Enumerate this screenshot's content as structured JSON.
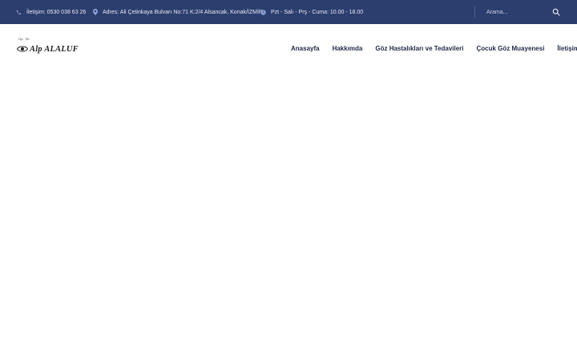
{
  "topbar": {
    "phone": "İletişim: 0530 038 63 26",
    "address": "Adres: Ali Çetinkaya Bulvarı No:71 K:2/4 Alsancak, Konak/İZMİR",
    "hours": "Pzt - Salı - Prş - Cuma: 10.00 - 18.00",
    "search_placeholder": "Arama..."
  },
  "logo": {
    "prefix": "Op. Dr.",
    "name": "Alp ALALUF"
  },
  "nav": {
    "items": [
      {
        "label": "Anasayfa"
      },
      {
        "label": "Hakkımda"
      },
      {
        "label": "Göz Hastalıkları ve Tedavileri"
      },
      {
        "label": "Çocuk Göz Muayenesi"
      },
      {
        "label": "İletişim"
      }
    ]
  },
  "colors": {
    "topbar_bg": "#2c3e6e",
    "nav_text": "#1f2a44",
    "icon_accent": "#8fa3d6"
  }
}
